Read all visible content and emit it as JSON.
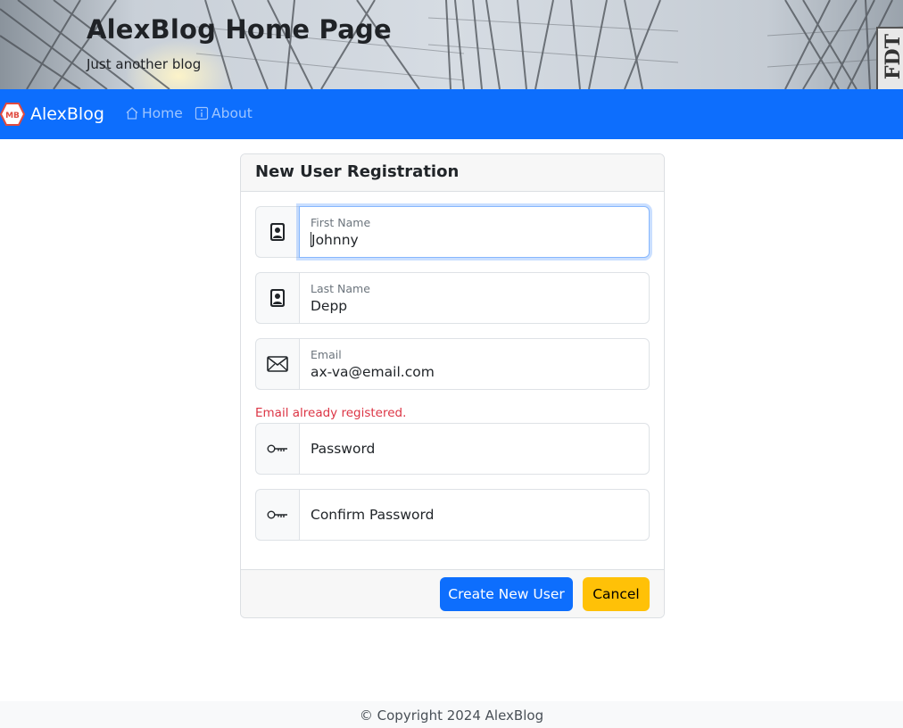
{
  "header": {
    "title": "AlexBlog Home Page",
    "subtitle": "Just another blog",
    "badge_text": "FDT"
  },
  "navbar": {
    "brand_logo_text": "MB",
    "brand": "AlexBlog",
    "links": [
      {
        "label": "Home",
        "icon": "house-icon"
      },
      {
        "label": "About",
        "icon": "info-square-icon"
      }
    ],
    "colors": {
      "background": "#0d6efd"
    }
  },
  "form": {
    "title": "New User Registration",
    "fields": [
      {
        "label": "First Name",
        "value": "Johnny",
        "icon": "person-badge-icon",
        "focused": true
      },
      {
        "label": "Last Name",
        "value": "Depp",
        "icon": "person-badge-icon"
      },
      {
        "label": "Email",
        "value": "ax-va@email.com",
        "icon": "envelope-icon"
      },
      {
        "placeholder": "Password",
        "icon": "key-icon"
      },
      {
        "placeholder": "Confirm Password",
        "icon": "key-icon"
      }
    ],
    "error": "Email already registered.",
    "submit_label": "Create New User",
    "cancel_label": "Cancel",
    "colors": {
      "primary": "#0d6efd",
      "warning": "#ffc107",
      "danger": "#dc3545"
    }
  },
  "footer": {
    "text": "© Copyright 2024 AlexBlog"
  }
}
